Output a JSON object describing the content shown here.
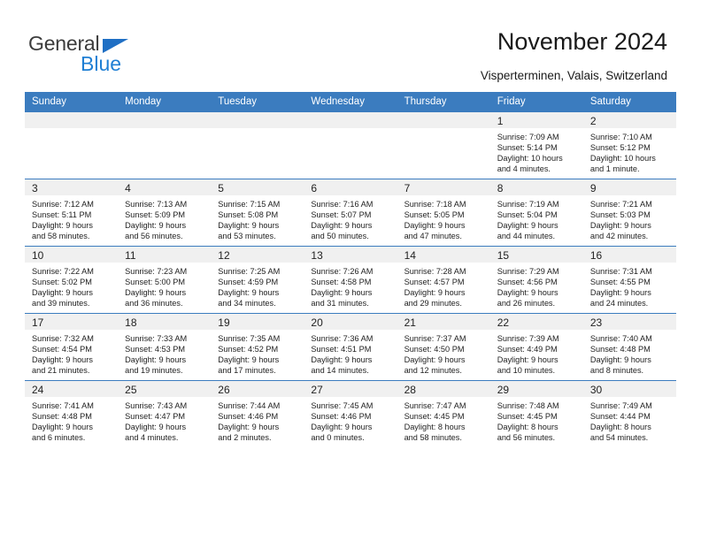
{
  "brand": {
    "name_part1": "General",
    "name_part2": "Blue",
    "accent_color": "#1f7fd4",
    "triangle_color": "#1f6fc4"
  },
  "header": {
    "title": "November 2024",
    "subtitle": "Visperterminen, Valais, Switzerland",
    "header_bg": "#3b7cbf",
    "daynum_band_bg": "#f0f0f0"
  },
  "calendar": {
    "weekday_headers": [
      "Sunday",
      "Monday",
      "Tuesday",
      "Wednesday",
      "Thursday",
      "Friday",
      "Saturday"
    ],
    "weeks": [
      [
        {
          "day": "",
          "sunrise": "",
          "sunset": "",
          "daylight_line1": "",
          "daylight_line2": "",
          "empty": true
        },
        {
          "day": "",
          "sunrise": "",
          "sunset": "",
          "daylight_line1": "",
          "daylight_line2": "",
          "empty": true
        },
        {
          "day": "",
          "sunrise": "",
          "sunset": "",
          "daylight_line1": "",
          "daylight_line2": "",
          "empty": true
        },
        {
          "day": "",
          "sunrise": "",
          "sunset": "",
          "daylight_line1": "",
          "daylight_line2": "",
          "empty": true
        },
        {
          "day": "",
          "sunrise": "",
          "sunset": "",
          "daylight_line1": "",
          "daylight_line2": "",
          "empty": true
        },
        {
          "day": "1",
          "sunrise": "Sunrise: 7:09 AM",
          "sunset": "Sunset: 5:14 PM",
          "daylight_line1": "Daylight: 10 hours",
          "daylight_line2": "and 4 minutes."
        },
        {
          "day": "2",
          "sunrise": "Sunrise: 7:10 AM",
          "sunset": "Sunset: 5:12 PM",
          "daylight_line1": "Daylight: 10 hours",
          "daylight_line2": "and 1 minute."
        }
      ],
      [
        {
          "day": "3",
          "sunrise": "Sunrise: 7:12 AM",
          "sunset": "Sunset: 5:11 PM",
          "daylight_line1": "Daylight: 9 hours",
          "daylight_line2": "and 58 minutes."
        },
        {
          "day": "4",
          "sunrise": "Sunrise: 7:13 AM",
          "sunset": "Sunset: 5:09 PM",
          "daylight_line1": "Daylight: 9 hours",
          "daylight_line2": "and 56 minutes."
        },
        {
          "day": "5",
          "sunrise": "Sunrise: 7:15 AM",
          "sunset": "Sunset: 5:08 PM",
          "daylight_line1": "Daylight: 9 hours",
          "daylight_line2": "and 53 minutes."
        },
        {
          "day": "6",
          "sunrise": "Sunrise: 7:16 AM",
          "sunset": "Sunset: 5:07 PM",
          "daylight_line1": "Daylight: 9 hours",
          "daylight_line2": "and 50 minutes."
        },
        {
          "day": "7",
          "sunrise": "Sunrise: 7:18 AM",
          "sunset": "Sunset: 5:05 PM",
          "daylight_line1": "Daylight: 9 hours",
          "daylight_line2": "and 47 minutes."
        },
        {
          "day": "8",
          "sunrise": "Sunrise: 7:19 AM",
          "sunset": "Sunset: 5:04 PM",
          "daylight_line1": "Daylight: 9 hours",
          "daylight_line2": "and 44 minutes."
        },
        {
          "day": "9",
          "sunrise": "Sunrise: 7:21 AM",
          "sunset": "Sunset: 5:03 PM",
          "daylight_line1": "Daylight: 9 hours",
          "daylight_line2": "and 42 minutes."
        }
      ],
      [
        {
          "day": "10",
          "sunrise": "Sunrise: 7:22 AM",
          "sunset": "Sunset: 5:02 PM",
          "daylight_line1": "Daylight: 9 hours",
          "daylight_line2": "and 39 minutes."
        },
        {
          "day": "11",
          "sunrise": "Sunrise: 7:23 AM",
          "sunset": "Sunset: 5:00 PM",
          "daylight_line1": "Daylight: 9 hours",
          "daylight_line2": "and 36 minutes."
        },
        {
          "day": "12",
          "sunrise": "Sunrise: 7:25 AM",
          "sunset": "Sunset: 4:59 PM",
          "daylight_line1": "Daylight: 9 hours",
          "daylight_line2": "and 34 minutes."
        },
        {
          "day": "13",
          "sunrise": "Sunrise: 7:26 AM",
          "sunset": "Sunset: 4:58 PM",
          "daylight_line1": "Daylight: 9 hours",
          "daylight_line2": "and 31 minutes."
        },
        {
          "day": "14",
          "sunrise": "Sunrise: 7:28 AM",
          "sunset": "Sunset: 4:57 PM",
          "daylight_line1": "Daylight: 9 hours",
          "daylight_line2": "and 29 minutes."
        },
        {
          "day": "15",
          "sunrise": "Sunrise: 7:29 AM",
          "sunset": "Sunset: 4:56 PM",
          "daylight_line1": "Daylight: 9 hours",
          "daylight_line2": "and 26 minutes."
        },
        {
          "day": "16",
          "sunrise": "Sunrise: 7:31 AM",
          "sunset": "Sunset: 4:55 PM",
          "daylight_line1": "Daylight: 9 hours",
          "daylight_line2": "and 24 minutes."
        }
      ],
      [
        {
          "day": "17",
          "sunrise": "Sunrise: 7:32 AM",
          "sunset": "Sunset: 4:54 PM",
          "daylight_line1": "Daylight: 9 hours",
          "daylight_line2": "and 21 minutes."
        },
        {
          "day": "18",
          "sunrise": "Sunrise: 7:33 AM",
          "sunset": "Sunset: 4:53 PM",
          "daylight_line1": "Daylight: 9 hours",
          "daylight_line2": "and 19 minutes."
        },
        {
          "day": "19",
          "sunrise": "Sunrise: 7:35 AM",
          "sunset": "Sunset: 4:52 PM",
          "daylight_line1": "Daylight: 9 hours",
          "daylight_line2": "and 17 minutes."
        },
        {
          "day": "20",
          "sunrise": "Sunrise: 7:36 AM",
          "sunset": "Sunset: 4:51 PM",
          "daylight_line1": "Daylight: 9 hours",
          "daylight_line2": "and 14 minutes."
        },
        {
          "day": "21",
          "sunrise": "Sunrise: 7:37 AM",
          "sunset": "Sunset: 4:50 PM",
          "daylight_line1": "Daylight: 9 hours",
          "daylight_line2": "and 12 minutes."
        },
        {
          "day": "22",
          "sunrise": "Sunrise: 7:39 AM",
          "sunset": "Sunset: 4:49 PM",
          "daylight_line1": "Daylight: 9 hours",
          "daylight_line2": "and 10 minutes."
        },
        {
          "day": "23",
          "sunrise": "Sunrise: 7:40 AM",
          "sunset": "Sunset: 4:48 PM",
          "daylight_line1": "Daylight: 9 hours",
          "daylight_line2": "and 8 minutes."
        }
      ],
      [
        {
          "day": "24",
          "sunrise": "Sunrise: 7:41 AM",
          "sunset": "Sunset: 4:48 PM",
          "daylight_line1": "Daylight: 9 hours",
          "daylight_line2": "and 6 minutes."
        },
        {
          "day": "25",
          "sunrise": "Sunrise: 7:43 AM",
          "sunset": "Sunset: 4:47 PM",
          "daylight_line1": "Daylight: 9 hours",
          "daylight_line2": "and 4 minutes."
        },
        {
          "day": "26",
          "sunrise": "Sunrise: 7:44 AM",
          "sunset": "Sunset: 4:46 PM",
          "daylight_line1": "Daylight: 9 hours",
          "daylight_line2": "and 2 minutes."
        },
        {
          "day": "27",
          "sunrise": "Sunrise: 7:45 AM",
          "sunset": "Sunset: 4:46 PM",
          "daylight_line1": "Daylight: 9 hours",
          "daylight_line2": "and 0 minutes."
        },
        {
          "day": "28",
          "sunrise": "Sunrise: 7:47 AM",
          "sunset": "Sunset: 4:45 PM",
          "daylight_line1": "Daylight: 8 hours",
          "daylight_line2": "and 58 minutes."
        },
        {
          "day": "29",
          "sunrise": "Sunrise: 7:48 AM",
          "sunset": "Sunset: 4:45 PM",
          "daylight_line1": "Daylight: 8 hours",
          "daylight_line2": "and 56 minutes."
        },
        {
          "day": "30",
          "sunrise": "Sunrise: 7:49 AM",
          "sunset": "Sunset: 4:44 PM",
          "daylight_line1": "Daylight: 8 hours",
          "daylight_line2": "and 54 minutes."
        }
      ]
    ]
  }
}
